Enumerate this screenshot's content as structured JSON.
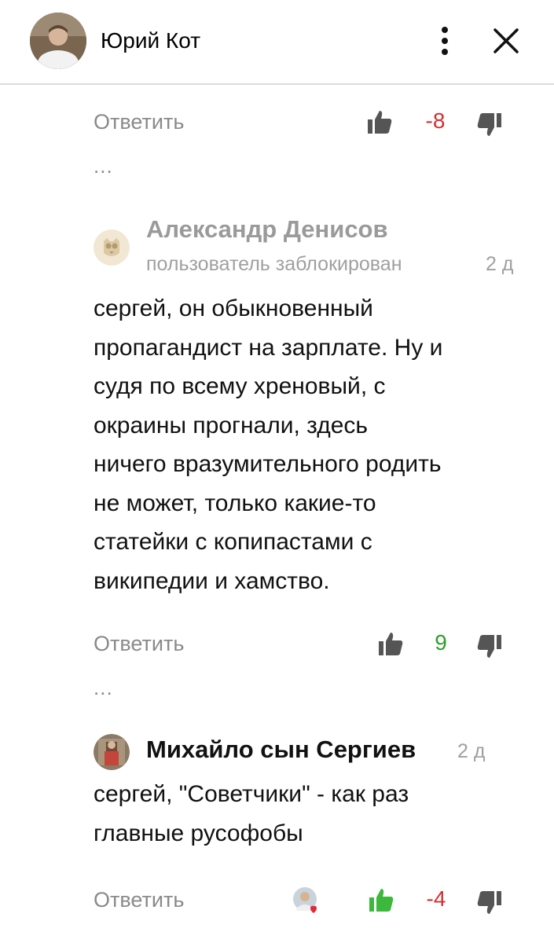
{
  "header": {
    "name": "Юрий Кот",
    "icons": {
      "more": "more-vertical-icon",
      "close": "close-icon"
    }
  },
  "comments": [
    {
      "reply_label": "Ответить",
      "score": "-8",
      "score_color": "#d32f2f",
      "more": "..."
    },
    {
      "author": "Александр Денисов",
      "status": "пользователь заблокирован",
      "time": "2 д",
      "text_lines": [
        "сергей, он обыкновенный",
        "пропагандист на зарплате. Ну и",
        "судя по всему хреновый, с",
        "окраины прогнали, здесь",
        "ничего вразумительного родить",
        "не может, только какие-то",
        "статейки с копипастами с",
        "википедии и хамство."
      ],
      "reply_label": "Ответить",
      "score": "9",
      "score_color": "#2e9e2e",
      "more": "..."
    },
    {
      "author": "Михайло сын Сергиев",
      "time": "2 д",
      "text_lines": [
        "сергей, \"Советчики\" - как раз",
        "главные русофобы"
      ],
      "reply_label": "Ответить",
      "score": "-4",
      "score_color": "#d32f2f",
      "liked": true
    }
  ],
  "colors": {
    "liked_thumb": "#3cb83c",
    "thumb": "#555555",
    "muted": "#8a8a8a"
  }
}
